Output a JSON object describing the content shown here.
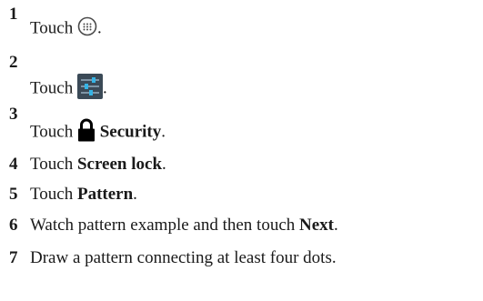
{
  "steps": [
    {
      "number": "1",
      "prefix": "Touch",
      "suffix": ".",
      "icon": "apps-launcher-icon"
    },
    {
      "number": "2",
      "prefix": "Touch",
      "suffix": ".",
      "icon": "settings-icon"
    },
    {
      "number": "3",
      "prefix": "Touch",
      "bold": "Security",
      "suffix": ".",
      "icon": "lock-icon"
    },
    {
      "number": "4",
      "prefix": "Touch",
      "bold": "Screen lock",
      "suffix": "."
    },
    {
      "number": "5",
      "prefix": "Touch",
      "bold": "Pattern",
      "suffix": "."
    },
    {
      "number": "6",
      "prefix": "Watch pattern example and then touch",
      "bold": "Next",
      "suffix": "."
    },
    {
      "number": "7",
      "prefix": "Draw a pattern connecting at least four dots."
    }
  ],
  "colors": {
    "text": "#1a1a1a",
    "settings_icon_bg": "#3b4a57",
    "settings_icon_slider": "#35b4e6"
  }
}
